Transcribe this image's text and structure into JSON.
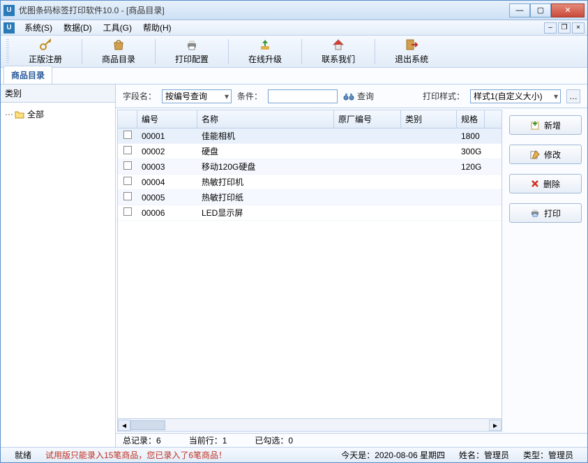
{
  "titlebar": {
    "app_icon_text": "U",
    "title": "优图条码标签打印软件10.0 - [商品目录]"
  },
  "menus": [
    {
      "label": "系统(S)"
    },
    {
      "label": "数据(D)"
    },
    {
      "label": "工具(G)"
    },
    {
      "label": "帮助(H)"
    }
  ],
  "toolbar": [
    {
      "key": "register",
      "label": "正版注册"
    },
    {
      "key": "catalog",
      "label": "商品目录"
    },
    {
      "key": "printcfg",
      "label": "打印配置"
    },
    {
      "key": "upgrade",
      "label": "在线升级"
    },
    {
      "key": "contact",
      "label": "联系我们"
    },
    {
      "key": "exit",
      "label": "退出系统"
    }
  ],
  "tab": {
    "label": "商品目录"
  },
  "sidebar": {
    "header": "类别",
    "root_label": "全部"
  },
  "filter": {
    "field_label": "字段名：",
    "field_value": "按编号查询",
    "cond_label": "条件：",
    "cond_value": "",
    "query_label": "查询",
    "style_label": "打印样式：",
    "style_value": "样式1(自定义大小)"
  },
  "grid": {
    "columns": [
      "编号",
      "名称",
      "原厂编号",
      "类别",
      "规格"
    ],
    "rows": [
      {
        "id": "00001",
        "name": "佳能相机",
        "oem": "",
        "cat": "",
        "spec": "1800"
      },
      {
        "id": "00002",
        "name": "硬盘",
        "oem": "",
        "cat": "",
        "spec": "300G"
      },
      {
        "id": "00003",
        "name": "移动120G硬盘",
        "oem": "",
        "cat": "",
        "spec": "120G"
      },
      {
        "id": "00004",
        "name": "热敏打印机",
        "oem": "",
        "cat": "",
        "spec": ""
      },
      {
        "id": "00005",
        "name": "热敏打印纸",
        "oem": "",
        "cat": "",
        "spec": ""
      },
      {
        "id": "00006",
        "name": "LED显示屏",
        "oem": "",
        "cat": "",
        "spec": ""
      }
    ]
  },
  "actions": {
    "add": "新增",
    "edit": "修改",
    "del": "删除",
    "print": "打印"
  },
  "status1": {
    "total": "总记录：6",
    "current": "当前行：1",
    "checked": "已勾选：0"
  },
  "status2": {
    "ready": "就绪",
    "trial": "试用版只能录入15笔商品，您已录入了6笔商品！",
    "today": "今天是：2020-08-06 星期四",
    "user": "姓名：管理员",
    "role": "类型：管理员"
  }
}
